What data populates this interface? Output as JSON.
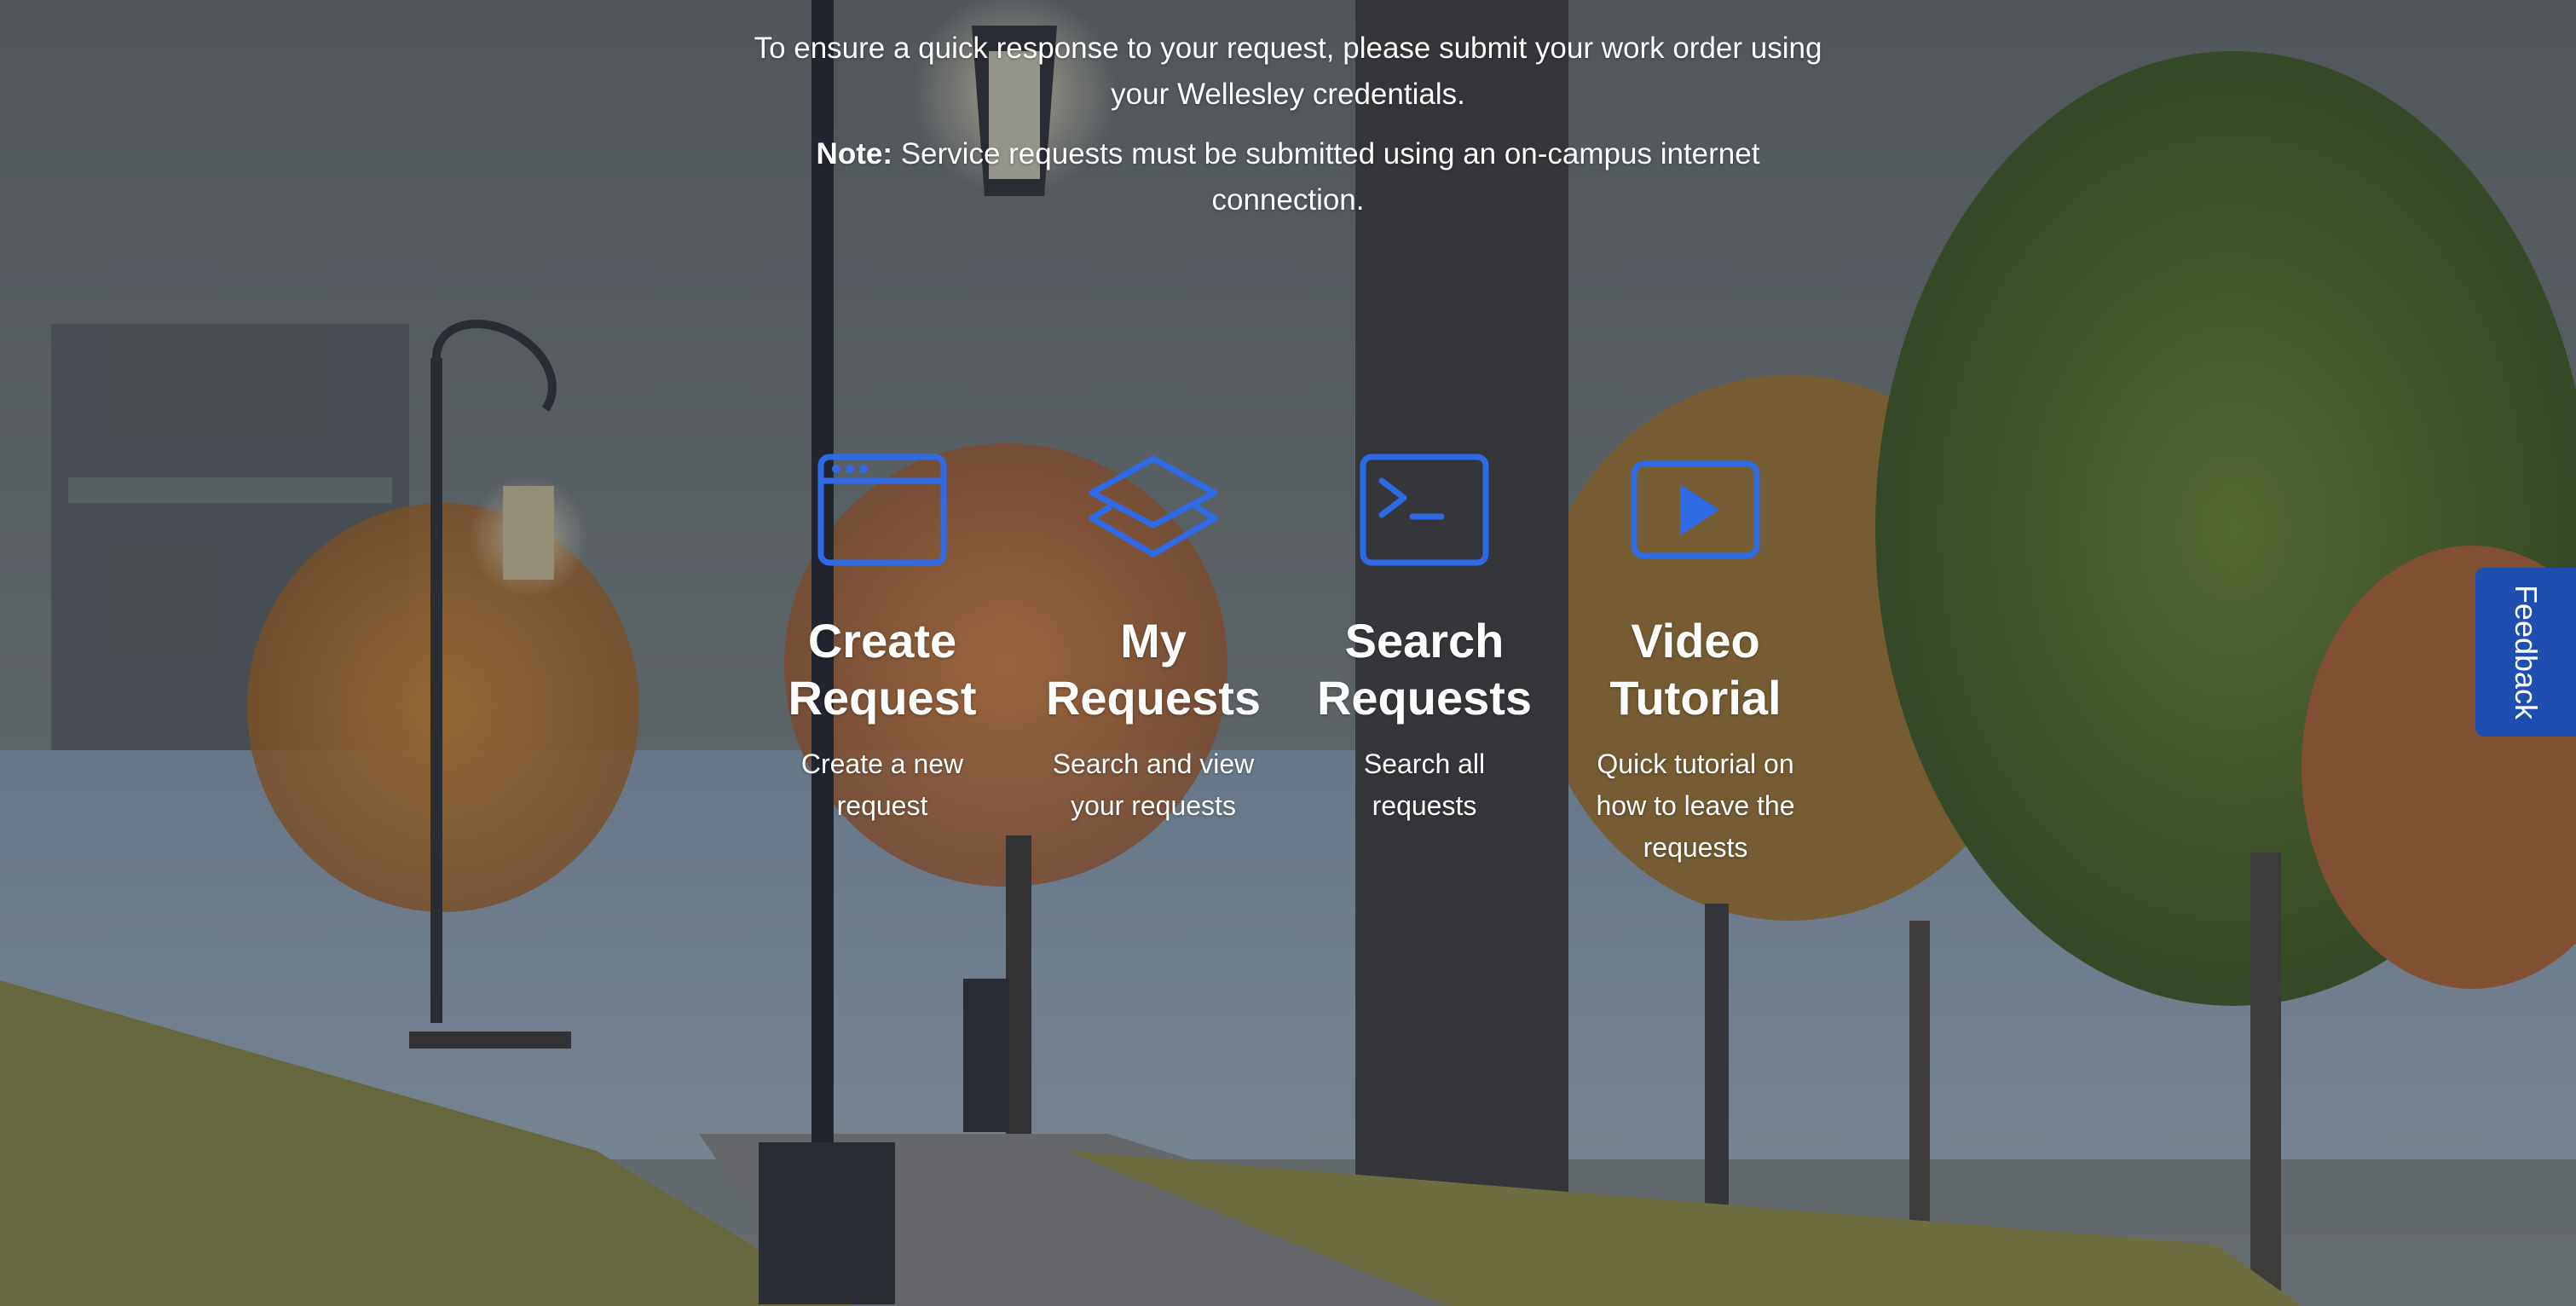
{
  "intro": {
    "line1": "To ensure a quick response to your request, please submit your work order using your Wellesley credentials.",
    "note_label": "Note:",
    "note_text": " Service requests must be submitted using an on-campus internet connection."
  },
  "cards": [
    {
      "title": "Create Request",
      "description": "Create a new request",
      "icon": "browser-window-icon"
    },
    {
      "title": "My Requests",
      "description": "Search and view your requests",
      "icon": "layers-icon"
    },
    {
      "title": "Search Requests",
      "description": "Search all requests",
      "icon": "terminal-icon"
    },
    {
      "title": "Video Tutorial",
      "description": "Quick tutorial on how to leave the requests",
      "icon": "video-play-icon"
    }
  ],
  "feedback": {
    "label": "Feedback"
  },
  "colors": {
    "icon_blue": "#2f6ae6",
    "feedback_bg": "#1e4fb0",
    "text": "#ffffff"
  }
}
